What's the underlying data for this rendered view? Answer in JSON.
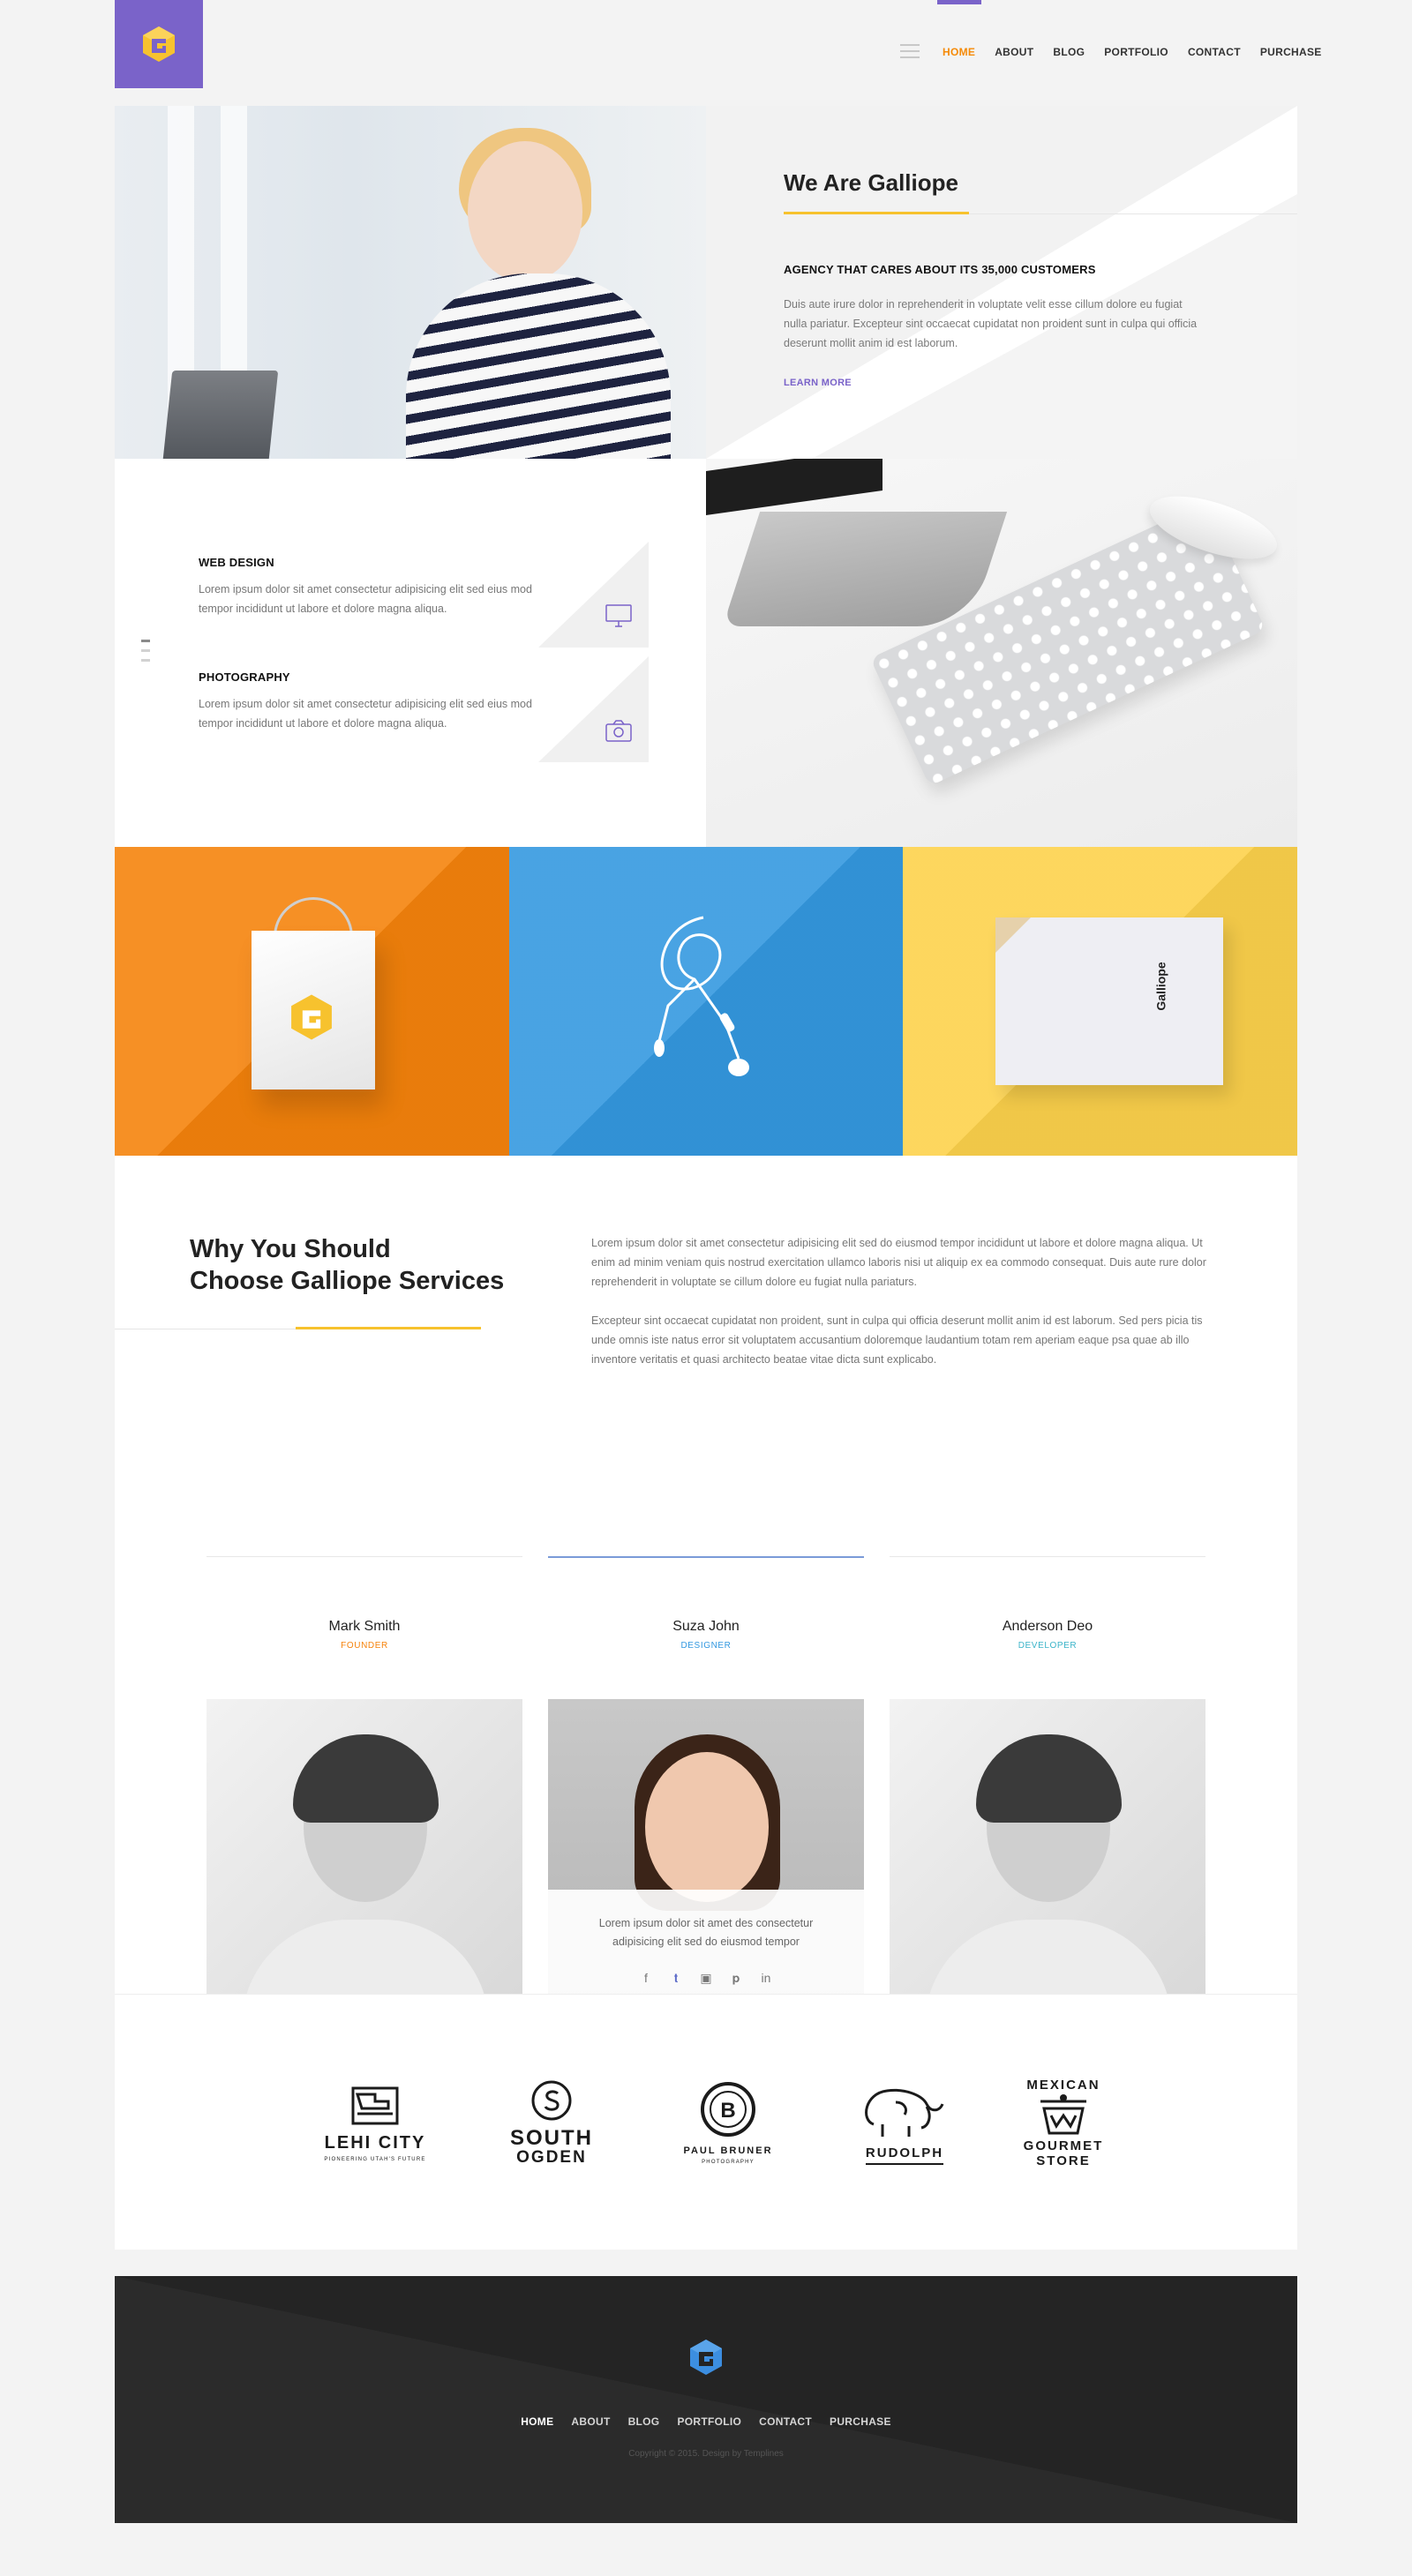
{
  "header": {
    "nav": [
      "HOME",
      "ABOUT",
      "BLOG",
      "PORTFOLIO",
      "CONTACT",
      "PURCHASE"
    ],
    "active_nav": "HOME",
    "menu_icon": "hamburger-icon",
    "logo_icon": "galliope-g-logo"
  },
  "hero": {
    "title_prefix": "We Are",
    "title_brand": "Galliope",
    "subtitle": "AGENCY THAT CARES ABOUT ITS 35,000 CUSTOMERS",
    "paragraph": "Duis aute irure dolor in reprehenderit in voluptate velit esse cillum dolore eu fugiat nulla pariatur. Excepteur sint occaecat cupidatat non proident sunt in culpa qui officia deserunt mollit anim id est laborum.",
    "cta": "LEARN MORE"
  },
  "services": [
    {
      "title": "WEB DESIGN",
      "description": "Lorem ipsum dolor sit amet consectetur adipisicing elit sed eius mod tempor incididunt ut labore et dolore magna aliqua.",
      "icon": "monitor-icon"
    },
    {
      "title": "PHOTOGRAPHY",
      "description": "Lorem ipsum dolor sit amet consectetur adipisicing elit sed eius mod tempor incididunt ut labore et dolore magna aliqua.",
      "icon": "camera-icon"
    }
  ],
  "portfolio_tiles": [
    {
      "subject": "shopping-bag",
      "color": "#f5830c"
    },
    {
      "subject": "earphones",
      "color": "#3499e0"
    },
    {
      "subject": "brand-book",
      "color": "#fdd24c",
      "brand": "Galliope"
    }
  ],
  "why": {
    "title_line1": "Why You Should",
    "title_line2": "Choose Galliope Services",
    "paragraph1": "Lorem ipsum dolor sit amet consectetur adipisicing elit sed do eiusmod tempor incididunt ut labore et dolore magna aliqua. Ut enim ad minim veniam quis nostrud exercitation ullamco laboris nisi ut aliquip ex ea commodo consequat. Duis aute rure dolor reprehenderit in voluptate se cillum dolore eu fugiat nulla pariaturs.",
    "paragraph2": "Excepteur sint occaecat cupidatat non proident, sunt in culpa qui officia deserunt mollit anim id est laborum. Sed pers picia tis unde omnis iste natus error sit voluptatem accusantium doloremque laudantium totam rem aperiam eaque psa quae ab illo inventore veritatis et quasi architecto beatae vitae dicta sunt explicabo."
  },
  "team": [
    {
      "name": "Mark Smith",
      "role": "FOUNDER",
      "role_color": "#f5830c"
    },
    {
      "name": "Suza John",
      "role": "DESIGNER",
      "role_color": "#3499e0",
      "hover_text": "Lorem ipsum dolor sit amet des consectetur adipisicing elit sed do eiusmod tempor",
      "socials": [
        "f",
        "t",
        "ig",
        "p",
        "in"
      ]
    },
    {
      "name": "Anderson Deo",
      "role": "DEVELOPER",
      "role_color": "#3bb4c9"
    }
  ],
  "clients": [
    {
      "name": "LEHI CITY",
      "sub": "PIONEERING UTAH'S FUTURE"
    },
    {
      "name": "SOUTH",
      "name2": "OGDEN"
    },
    {
      "name": "PAUL BRUNER",
      "sub": "PHOTOGRAPHY"
    },
    {
      "name": "RUDOLPH"
    },
    {
      "name": "MEXICAN",
      "name2": "GOURMET",
      "name3": "STORE"
    }
  ],
  "footer": {
    "nav": [
      "HOME",
      "ABOUT",
      "BLOG",
      "PORTFOLIO",
      "CONTACT",
      "PURCHASE"
    ],
    "copyright": "Copyright © 2015. Design by Templines"
  },
  "colors": {
    "accent_purple": "#7a63c9",
    "accent_orange": "#f5830c",
    "accent_yellow": "#f7c22e",
    "accent_blue": "#3499e0"
  }
}
